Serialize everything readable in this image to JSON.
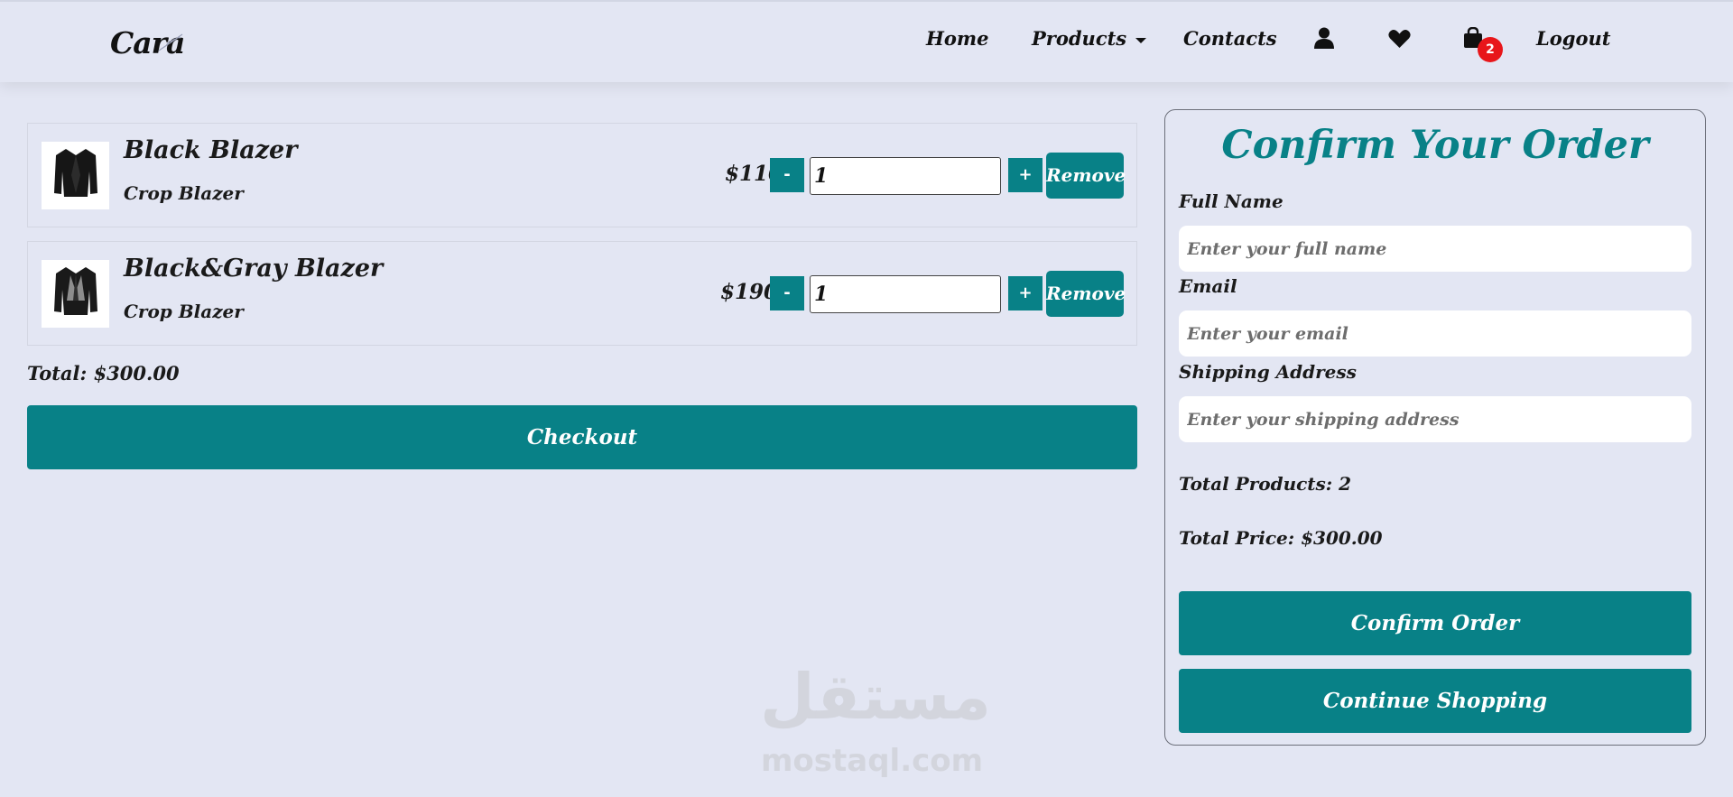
{
  "header": {
    "logo": "Cara",
    "nav": {
      "home": "Home",
      "products": "Products",
      "contacts": "Contacts",
      "logout": "Logout"
    },
    "cart_count": "2",
    "icons": [
      "user-icon",
      "heart-icon",
      "shopping-bag-icon"
    ]
  },
  "cart": {
    "items": [
      {
        "name": "Black Blazer",
        "subtitle": "Crop Blazer",
        "price": "$110",
        "minus": "-",
        "quantity": "1",
        "plus": "+",
        "remove": "Remove"
      },
      {
        "name": "Black&Gray Blazer",
        "subtitle": "Crop Blazer",
        "price": "$190",
        "minus": "-",
        "quantity": "1",
        "plus": "+",
        "remove": "Remove"
      }
    ],
    "total": "Total: $300.00",
    "checkout": "Checkout"
  },
  "order": {
    "title": "Confirm Your Order",
    "full_name_label": "Full Name",
    "full_name_placeholder": "Enter your full name",
    "email_label": "Email",
    "email_placeholder": "Enter your email",
    "address_label": "Shipping Address",
    "address_placeholder": "Enter your shipping address",
    "total_products": "Total Products: 2",
    "total_price": "Total Price: $300.00",
    "confirm": "Confirm Order",
    "continue": "Continue Shopping"
  },
  "watermark": {
    "arabic": "مستقل",
    "latin": "mostaql.com"
  },
  "colors": {
    "accent": "#088187",
    "background": "#e3e6f3",
    "badge": "#e8161a"
  }
}
